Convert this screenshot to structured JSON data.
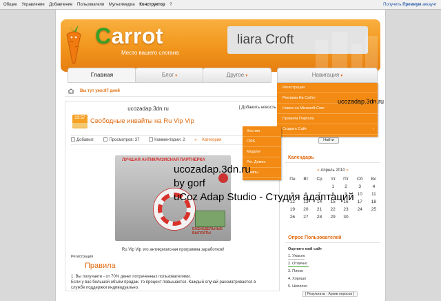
{
  "adminbar": {
    "items": [
      "Общее",
      "Управление",
      "Добавление",
      "Пользователи",
      "Мультимедиа",
      "Конструктор",
      "?"
    ],
    "premium_prefix": "Получить",
    "premium_bold": "Премиум",
    "premium_suffix": "аккаунт"
  },
  "header": {
    "logo_letter": "C",
    "logo_rest": "arrot",
    "slogan": "Место вашего слогана",
    "banner_text": "liara Croft"
  },
  "nav": {
    "tabs": [
      "Главная",
      "Блог",
      "Другое",
      "Навигация"
    ],
    "dropdown_arrow": "▾"
  },
  "breadcrumb": {
    "text": "Вы тут уже:87 дней"
  },
  "post": {
    "site": "ucozadap.3dn.ru",
    "add_news": "[ Добавить новость ]",
    "time": "23:57",
    "title": "Свободные инвайты на Ru Vip Vip",
    "added_label": "Добавил:",
    "views": "Просмотров: 37",
    "comments": "Комментарии: 2",
    "category": "Категория",
    "promo_heading": "ЛУЧШАЯ АНТИКРИЗИСНАЯ ПАРТНЕРКА",
    "promo_payout": "ЕЖЕНЕДЕЛЬНЫЕ ВЫПЛАТЫ",
    "caption": "Ru Vip Vip это антикризисная программа заработков!",
    "registration": "Регистрация",
    "rules_heading": "Правила",
    "rules_lines": [
      "1. Вы получаете - от 70% денег потраченных пользователями.",
      "Если у вас большой объём продаж, то процент повышается. Каждый случай рассматривается в",
      "службе поддержки индивидуально."
    ]
  },
  "nav_menu": {
    "items": [
      "Регистрация",
      "Реклама На Сайте",
      "Новое на Microsoft.Com",
      "Правила Портала",
      "Создать Сайт"
    ],
    "chevron": "›"
  },
  "sub_menu": {
    "items": [
      "Хостинг",
      "CMS",
      "Модули",
      "Рег. Домен",
      "Компы"
    ]
  },
  "sidebar": {
    "search_button": "Найти",
    "calendar_title": "Календарь",
    "month_prev": "«",
    "month": "Апрель 2010",
    "month_next": "»",
    "weekdays": [
      "Пн",
      "Вт",
      "Ср",
      "Чт",
      "Пт",
      "Сб",
      "Вс"
    ],
    "weeks": [
      [
        "",
        "",
        "",
        "1",
        "2",
        "3",
        "4"
      ],
      [
        "5",
        "6",
        "7",
        "8",
        "9",
        "10",
        "11"
      ],
      [
        "12",
        "13",
        "14",
        "15",
        "16",
        "17",
        "18"
      ],
      [
        "19",
        "20",
        "21",
        "22",
        "23",
        "24",
        "25"
      ],
      [
        "26",
        "27",
        "28",
        "29",
        "30",
        "",
        ""
      ]
    ],
    "poll_title": "Опрос Пользователей",
    "poll_question": "Оцените мой сайт",
    "poll_options": [
      "1. Ужасно",
      "2. Отлично",
      "3. Плохо",
      "4. Хорошо",
      "5. Неплохо"
    ],
    "poll_results": "[ Результаты · Архив опросов ]"
  },
  "overlay": {
    "top_label": "ucozadap.3dn.ru",
    "lines": [
      "ucozadap.3dn.ru",
      "by gorf",
      "uCoz Adap Studio - Студия адаптаций"
    ]
  },
  "colors": {
    "accent": "#f28a13",
    "link_orange": "#e06a10",
    "logo_green": "#3aa028",
    "premium_blue": "#2255aa"
  }
}
